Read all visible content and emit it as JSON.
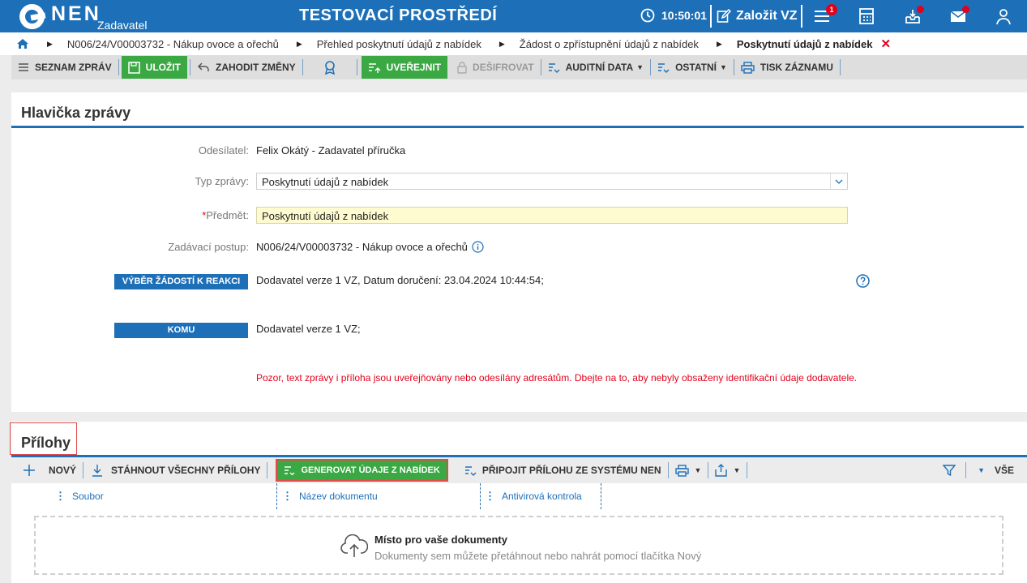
{
  "topbar": {
    "logo_text": "NEN",
    "logo_sub": "Zadavatel",
    "env_title": "TESTOVACÍ PROSTŘEDÍ",
    "time": "10:50:01",
    "create_label": "Založit VZ",
    "notif_count": "1",
    "accent_color": "#1d70b8"
  },
  "breadcrumb": {
    "items": [
      "N006/24/V00003732 - Nákup ovoce a ořechů",
      "Přehled poskytnutí údajů z nabídek",
      "Žádost o zpřístupnění údajů z nabídek",
      "Poskytnutí údajů z nabídek"
    ]
  },
  "toolbar": {
    "list_label": "SEZNAM ZPRÁV",
    "save_label": "ULOŽIT",
    "discard_label": "ZAHODIT ZMĚNY",
    "publish_label": "UVEŘEJNIT",
    "decrypt_label": "DEŠIFROVAT",
    "audit_label": "AUDITNÍ DATA",
    "other_label": "OSTATNÍ",
    "print_label": "TISK ZÁZNAMU"
  },
  "header_section": {
    "title": "Hlavička zprávy",
    "sender_label": "Odesílatel:",
    "sender_value": "Felix Okátý - Zadavatel příručka",
    "type_label": "Typ zprávy:",
    "type_value": "Poskytnutí údajů z nabídek",
    "subject_req": "*",
    "subject_label": "Předmět:",
    "subject_value": "Poskytnutí údajů z nabídek",
    "procedure_label": "Zadávací postup:",
    "procedure_value": "N006/24/V00003732 - Nákup ovoce a ořechů",
    "select_requests_label": "VÝBĚR ŽÁDOSTÍ K REAKCI",
    "select_requests_value": "Dodavatel verze 1 VZ, Datum doručení: 23.04.2024 10:44:54;",
    "to_label": "KOMU",
    "to_value": "Dodavatel verze 1 VZ;",
    "warning": "Pozor, text zprávy i příloha jsou uveřejňovány nebo odesílány adresátům. Dbejte na to, aby nebyly obsaženy identifikační údaje dodavatele."
  },
  "attachments": {
    "title": "Přílohy",
    "new_label": "NOVÝ",
    "download_all_label": "STÁHNOUT VŠECHNY PŘÍLOHY",
    "generate_label": "GENEROVAT ÚDAJE Z NABÍDEK",
    "attach_label": "PŘIPOJIT PŘÍLOHU ZE SYSTÉMU NEN",
    "all_label": "VŠE",
    "columns": [
      "Soubor",
      "Název dokumentu",
      "Antivirová kontrola"
    ],
    "drop_title": "Místo pro vaše dokumenty",
    "drop_sub": "Dokumenty sem můžete přetáhnout nebo nahrát pomocí tlačítka Nový"
  }
}
